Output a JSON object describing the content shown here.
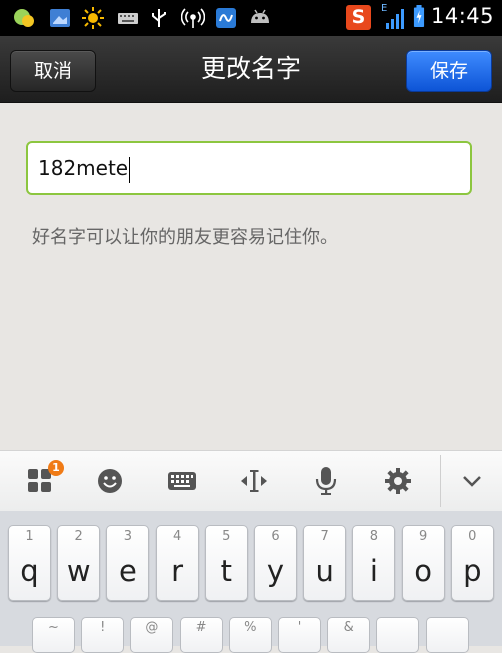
{
  "status_bar": {
    "time": "14:45",
    "sogou_letter": "S",
    "network_letter": "E",
    "accent": "#e8481c"
  },
  "header": {
    "cancel_label": "取消",
    "title": "更改名字",
    "save_label": "保存",
    "save_color": "#1a64e8"
  },
  "name_field": {
    "value": "182mete",
    "border_color": "#8cc63f"
  },
  "hint_text": "好名字可以让你的朋友更容易记住你。",
  "keyboard_toolbar": {
    "items": [
      "apps-icon",
      "emoji-icon",
      "keyboard-icon",
      "cursor-move-icon",
      "microphone-icon",
      "settings-icon",
      "collapse-icon"
    ],
    "badge": "1"
  },
  "keyboard": {
    "row1": [
      {
        "num": "1",
        "ch": "q"
      },
      {
        "num": "2",
        "ch": "w"
      },
      {
        "num": "3",
        "ch": "e"
      },
      {
        "num": "4",
        "ch": "r"
      },
      {
        "num": "5",
        "ch": "t"
      },
      {
        "num": "6",
        "ch": "y"
      },
      {
        "num": "7",
        "ch": "u"
      },
      {
        "num": "8",
        "ch": "i"
      },
      {
        "num": "9",
        "ch": "o"
      },
      {
        "num": "0",
        "ch": "p"
      }
    ],
    "row2": [
      {
        "sym": "~",
        "ch": ""
      },
      {
        "sym": "!",
        "ch": ""
      },
      {
        "sym": "@",
        "ch": ""
      },
      {
        "sym": "#",
        "ch": ""
      },
      {
        "sym": "%",
        "ch": ""
      },
      {
        "sym": "'",
        "ch": ""
      },
      {
        "sym": "&",
        "ch": ""
      },
      {
        "sym": "",
        "ch": ""
      },
      {
        "sym": "",
        "ch": ""
      }
    ]
  }
}
